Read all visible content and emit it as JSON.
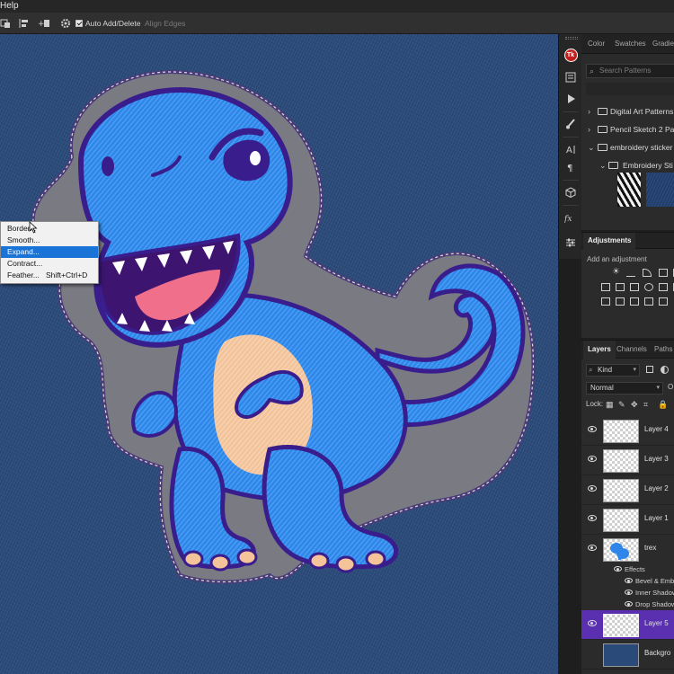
{
  "menubar": {
    "help": "Help"
  },
  "options": {
    "auto_add_delete": "Auto Add/Delete",
    "align_edges": "Align Edges"
  },
  "context_menu": {
    "items": [
      {
        "label": "Border...",
        "shortcut": ""
      },
      {
        "label": "Smooth...",
        "shortcut": ""
      },
      {
        "label": "Expand...",
        "shortcut": "",
        "selected": true
      },
      {
        "label": "Contract...",
        "shortcut": ""
      },
      {
        "label": "Feather...",
        "shortcut": "Shift+Ctrl+D"
      }
    ]
  },
  "toolstrip": {
    "tk_badge": "Tk"
  },
  "patterns_panel": {
    "tabs": [
      "Color",
      "Swatches",
      "Gradie"
    ],
    "search_placeholder": "Search Patterns",
    "groups": [
      {
        "label": "Digital Art Patterns"
      },
      {
        "label": "Pencil Sketch 2 Pa"
      },
      {
        "label": "embroidery sticker"
      }
    ],
    "subgroup": "Embroidery Sti"
  },
  "adjustments_panel": {
    "tab": "Adjustments",
    "add_label": "Add an adjustment"
  },
  "layers_panel": {
    "tabs": [
      "Layers",
      "Channels",
      "Paths"
    ],
    "filter_kind": "Kind",
    "blend_mode": "Normal",
    "opacity_abbrev": "O",
    "lock_label": "Lock:",
    "layers": [
      {
        "name": "Layer 4"
      },
      {
        "name": "Layer 3"
      },
      {
        "name": "Layer 2"
      },
      {
        "name": "Layer 1"
      },
      {
        "name": "trex"
      }
    ],
    "effects_label": "Effects",
    "effects": [
      "Bevel & Embo",
      "Inner Shadow",
      "Drop Shadow"
    ],
    "selected_layer": "Layer 5",
    "bottom_partial": "Backgro"
  },
  "colors": {
    "denim": "#2a4a79",
    "dino_blue": "#2f86e8",
    "dino_outline": "#3a1d8c",
    "belly": "#f2c29a",
    "selected_layer": "#5a2fb0",
    "menu_highlight": "#1a73d6"
  }
}
